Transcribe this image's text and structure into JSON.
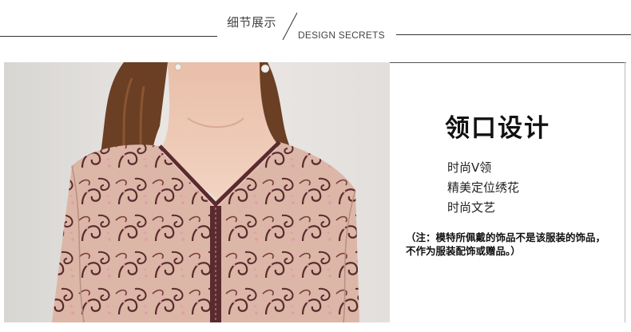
{
  "header": {
    "title_cn": "细节展示",
    "title_en": "DESIGN SECRETS"
  },
  "photo": {
    "alt": "",
    "colors": {
      "background": "#e6e3e0",
      "fabric": "#d9b3a4",
      "embroidery": "#5a2a2e",
      "hair": "#6b3f24",
      "skin": "#eec9b6"
    }
  },
  "detail": {
    "title": "领口设计",
    "features": [
      "时尚V领",
      "精美定位绣花",
      "时尚文艺"
    ],
    "note_line1": "（注：模特所佩戴的饰品不是该服装的饰品，",
    "note_line2": "不作为服装配饰或赠品。）"
  }
}
